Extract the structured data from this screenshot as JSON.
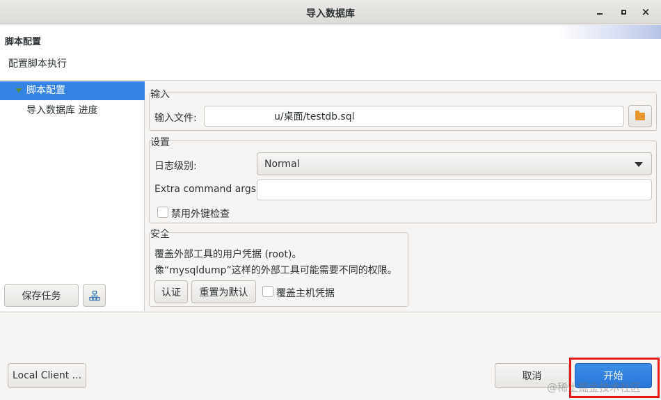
{
  "window": {
    "title": "导入数据库",
    "controls": {
      "minimize": "minimize-icon",
      "maximize": "maximize-icon",
      "close": "×"
    }
  },
  "header": {
    "title": "脚本配置",
    "description": "配置脚本执行"
  },
  "tree": {
    "items": [
      {
        "label": "脚本配置",
        "selected": true
      },
      {
        "label": "导入数据库 进度",
        "selected": false
      }
    ]
  },
  "left_buttons": {
    "save_task": "保存任务",
    "config_icon": "network-config-icon"
  },
  "input_group": {
    "title": "输入",
    "file_label": "输入文件:",
    "file_value": "u/桌面/testdb.sql",
    "browse_icon": "folder-icon"
  },
  "settings_group": {
    "title": "设置",
    "log_level_label": "日志级别:",
    "log_level_value": "Normal",
    "extra_args_label": "Extra command args:",
    "extra_args_value": "",
    "disable_fk_label": "禁用外键检查",
    "disable_fk_checked": false
  },
  "security_group": {
    "title": "安全",
    "line1": "覆盖外部工具的用户凭据 (root)。",
    "line2": "像“mysqldump”这样的外部工具可能需要不同的权限。",
    "auth_button": "认证",
    "reset_button": "重置为默认",
    "override_host_label": "覆盖主机凭据",
    "override_host_checked": false
  },
  "footer": {
    "local_client": "Local Client ...",
    "cancel": "取消",
    "start": "开始",
    "primary_color": "#3584e4",
    "highlight_color": "#e31b1b"
  },
  "watermark": "@稀土掘金技术社区"
}
